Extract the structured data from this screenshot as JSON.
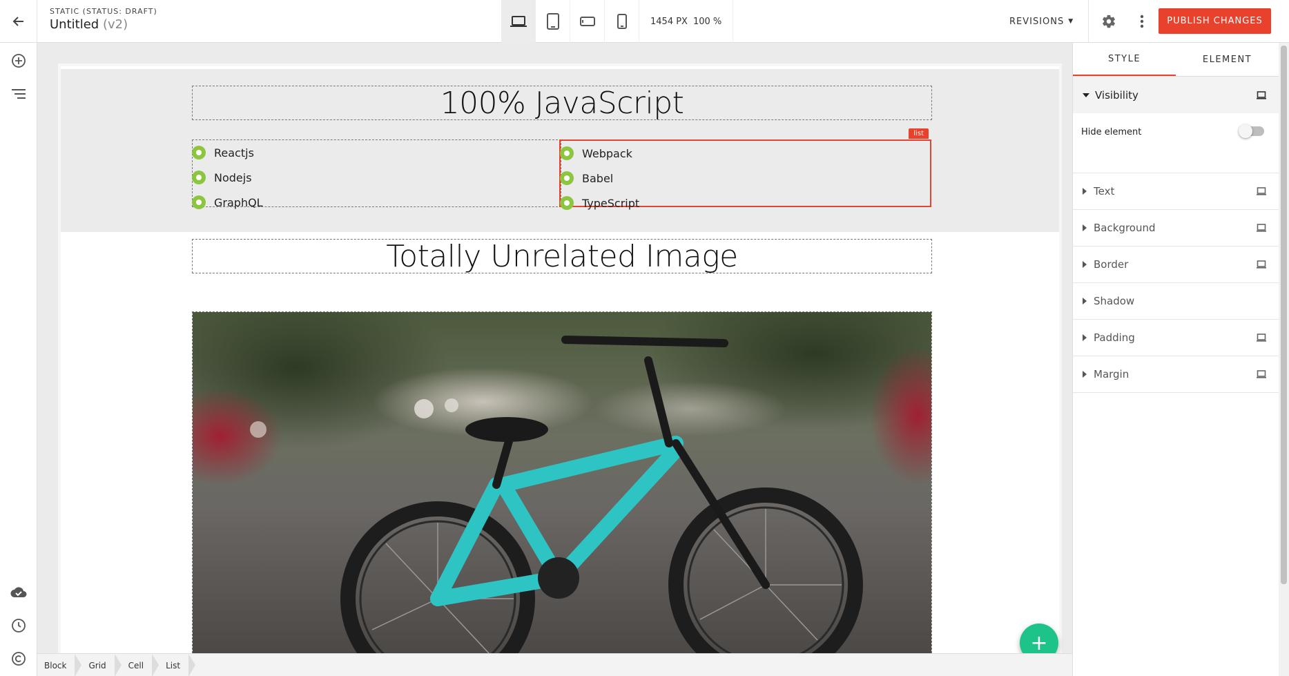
{
  "header": {
    "status": "STATIC (STATUS: DRAFT)",
    "title": "Untitled",
    "version": "(v2)",
    "viewport_width": "1454 PX",
    "zoom": "100 %",
    "revisions_label": "REVISIONS",
    "publish_label": "PUBLISH CHANGES"
  },
  "device_buttons": [
    {
      "name": "desktop",
      "icon": "laptop-icon",
      "active": true
    },
    {
      "name": "tablet",
      "icon": "tablet-icon",
      "active": false
    },
    {
      "name": "tablet-landscape",
      "icon": "tablet-landscape-icon",
      "active": false
    },
    {
      "name": "mobile",
      "icon": "phone-icon",
      "active": false
    }
  ],
  "left_rail": {
    "top": [
      "add-circle-icon",
      "layers-list-icon"
    ],
    "bottom": [
      "cloud-done-icon",
      "history-icon",
      "copyright-icon"
    ]
  },
  "canvas": {
    "heading1": "100% JavaScript",
    "list_left": [
      "Reactjs",
      "Nodejs",
      "GraphQL"
    ],
    "list_right": [
      "Webpack",
      "Babel",
      "TypeScript"
    ],
    "list_tag": "list",
    "heading2": "Totally Unrelated Image",
    "image_subject": "teal BMX bike on street"
  },
  "breadcrumb": [
    "Block",
    "Grid",
    "Cell",
    "List"
  ],
  "panel": {
    "tabs": [
      "STYLE",
      "ELEMENT"
    ],
    "active_tab": "STYLE",
    "visibility": {
      "label": "Visibility",
      "hide_label": "Hide element",
      "hidden": false
    },
    "sections": [
      {
        "label": "Text",
        "device_icon": true
      },
      {
        "label": "Background",
        "device_icon": true
      },
      {
        "label": "Border",
        "device_icon": true
      },
      {
        "label": "Shadow",
        "device_icon": false
      },
      {
        "label": "Padding",
        "device_icon": true
      },
      {
        "label": "Margin",
        "device_icon": true
      }
    ]
  },
  "colors": {
    "accent": "#e8412c",
    "fab": "#1ec38a",
    "bullet": "#8cc63f",
    "bike": "#2ec4c4"
  }
}
